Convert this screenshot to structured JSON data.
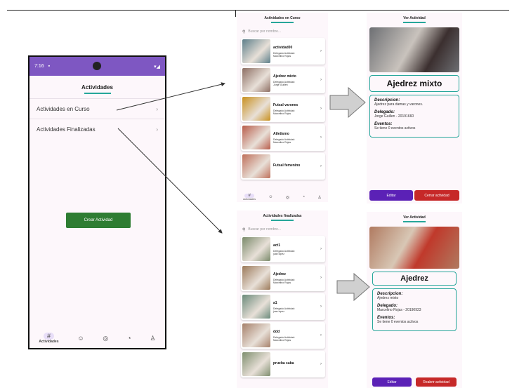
{
  "main_phone": {
    "status_time": "7:16",
    "status_icons": "▾◢",
    "title": "Actividades",
    "menu": [
      {
        "label": "Actividades en Curso"
      },
      {
        "label": "Actividades Finalizadas"
      }
    ],
    "create_button": "Crear Actividad",
    "nav": [
      {
        "icon": "#",
        "label": "Actividades"
      },
      {
        "icon": "☺",
        "label": ""
      },
      {
        "icon": "◎",
        "label": ""
      },
      {
        "icon": "◔",
        "label": ""
      },
      {
        "icon": "♙",
        "label": ""
      }
    ]
  },
  "current_list": {
    "title": "Actividades en Curso",
    "search_placeholder": "Buscar por nombre...",
    "items": [
      {
        "name": "actividad00",
        "sub": "Delegado Actividad:",
        "delegate": "Marcelino Rojas",
        "color": "#5d7f8a"
      },
      {
        "name": "Ajedrez mixto",
        "sub": "Delegado Actividad:",
        "delegate": "Jorge Guillen",
        "color": "#8d6e63"
      },
      {
        "name": "Futsal varones",
        "sub": "Delegado Actividad:",
        "delegate": "Marcelino Rojas",
        "color": "#c8901e"
      },
      {
        "name": "Atletismo",
        "sub": "Delegado Actividad:",
        "delegate": "Marcelino Rojas",
        "color": "#b85c4a"
      },
      {
        "name": "Futsal femenino",
        "sub": "",
        "delegate": "",
        "color": "#bf6f5a"
      }
    ],
    "nav": [
      {
        "icon": "#",
        "label": "Actividades"
      },
      {
        "icon": "☺",
        "label": ""
      },
      {
        "icon": "◎",
        "label": ""
      },
      {
        "icon": "◔",
        "label": ""
      },
      {
        "icon": "♙",
        "label": ""
      }
    ]
  },
  "finished_list": {
    "title": "Actividades finalizadas",
    "search_placeholder": "Buscar por nombre...",
    "items": [
      {
        "name": "act1",
        "sub": "Delegado Actividad:",
        "delegate": "juan lopez",
        "color": "#7a8a6a"
      },
      {
        "name": "Ajedrez",
        "sub": "Delegado Actividad:",
        "delegate": "Marcelino Rojas",
        "color": "#9c7a5a"
      },
      {
        "name": "a1",
        "sub": "Delegado Actividad:",
        "delegate": "juan lopez",
        "color": "#6a8a7a"
      },
      {
        "name": "ddd",
        "sub": "Delegado Actividad:",
        "delegate": "Marcelino Rojas",
        "color": "#a6806a"
      },
      {
        "name": "prueba saba",
        "sub": "",
        "delegate": "",
        "color": "#7f8f6f"
      }
    ]
  },
  "detail_current": {
    "title": "Ver Actividad",
    "name": "Ajedrez mixto",
    "desc_label": "Descripcion:",
    "desc": "Ajedrez para damas y varones.",
    "del_label": "Delegado:",
    "del": "Jorge Guillen - 20191660",
    "ev_label": "Eventos:",
    "ev": "Se tiene 0 eventos activos",
    "edit": "Editar",
    "action": "Cerrar actividad",
    "photo_color": "#6d6f73"
  },
  "detail_finished": {
    "title": "Ver Actividad",
    "name": "Ajedrez",
    "desc_label": "Descripcion:",
    "desc": "Ajedrez mixto",
    "del_label": "Delegado:",
    "del": "Marcelino Rojas - 20190923",
    "ev_label": "Eventos:",
    "ev": "Se tiene 0 eventos activos",
    "edit": "Editar",
    "action": "Reabrir actividad",
    "photo_color": "#b07a60"
  }
}
